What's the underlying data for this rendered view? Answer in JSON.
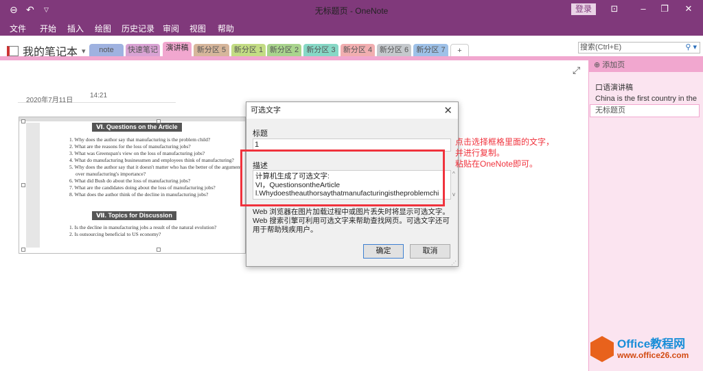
{
  "window": {
    "title": "无标题页 - OneNote",
    "login": "登录"
  },
  "icons": {
    "back": "back-icon",
    "undo": "undo-icon",
    "qat": "quick-access-dropdown-icon"
  },
  "menu": [
    "文件",
    "开始",
    "插入",
    "绘图",
    "历史记录",
    "审阅",
    "视图",
    "帮助"
  ],
  "notebook": {
    "name": "我的笔记本",
    "chev": "▾"
  },
  "tabs": [
    {
      "label": "note",
      "color": "#9fb2e0"
    },
    {
      "label": "快速笔记",
      "color": "#d9a3d4"
    },
    {
      "label": "演讲稿",
      "color": "#f1a7cf"
    },
    {
      "label": "新分区 5",
      "color": "#d6b69b"
    },
    {
      "label": "新分区 1",
      "color": "#c3dc84"
    },
    {
      "label": "新分区 2",
      "color": "#a9d48d"
    },
    {
      "label": "新分区 3",
      "color": "#86d8c6"
    },
    {
      "label": "新分区 4",
      "color": "#f1aeb0"
    },
    {
      "label": "新分区 6",
      "color": "#c5c9cd"
    },
    {
      "label": "新分区 7",
      "color": "#9ec1e8"
    },
    {
      "label": "+",
      "color": "#ffffff"
    }
  ],
  "search": {
    "placeholder": "搜索(Ctrl+E)"
  },
  "sidebar": {
    "add_page": "添加页",
    "pages": [
      {
        "title": "口语演讲稿",
        "preview": "China is the first country in the"
      },
      {
        "title": "无标题页"
      }
    ]
  },
  "page": {
    "date": "2020年7月11日",
    "time": "14:21"
  },
  "image": {
    "heading1": "Ⅵ. Questions on the Article",
    "questions": [
      "1. Why does the author say that manufacturing is the problem child?",
      "2. What are the reasons for the loss of manufacturing jobs?",
      "3. What was Greenspan's view on the loss of manufacturing jobs?",
      "4. What do manufacturing businessmen and employees think of manufacturing?",
      "5. Why does the author say that it doesn't matter who has the better of the argument",
      "over manufacturing's importance?",
      "6. What did Bush do about the loss of manufacturing jobs?",
      "7. What are the candidates doing about the loss of manufacturing jobs?",
      "8. What does the author think of the decline in manufacturing jobs?"
    ],
    "heading2": "Ⅶ. Topics for Discussion",
    "topics": [
      "1. Is the decline in manufacturing jobs a result of the natural evolution?",
      "2. Is outsourcing beneficial to US economy?"
    ]
  },
  "dialog": {
    "title": "可选文字",
    "title_label": "标题",
    "title_value": "1",
    "desc_label": "描述",
    "desc_lines": [
      "计算机生成了可选文字:",
      "VI，QuestionsontheArticle",
      "l.Whydoestheauthorsaythatmanufacturingistheproblemchi"
    ],
    "help": "Web 浏览器在图片加载过程中或图片丢失时将显示可选文字。Web 搜索引擎可利用可选文字来帮助查找网页。可选文字还可用于帮助残疾用户。",
    "ok": "确定",
    "cancel": "取消"
  },
  "annotation": [
    "点击选择框格里面的文字，",
    "并进行复制。",
    "粘贴在OneNote即可。"
  ],
  "watermark": {
    "brand": "Office教程网",
    "url": "www.office26.com"
  },
  "colors": {
    "titlebar": "#80397b",
    "accent_pink": "#f1a7cf",
    "annotation_red": "#f0323c"
  }
}
